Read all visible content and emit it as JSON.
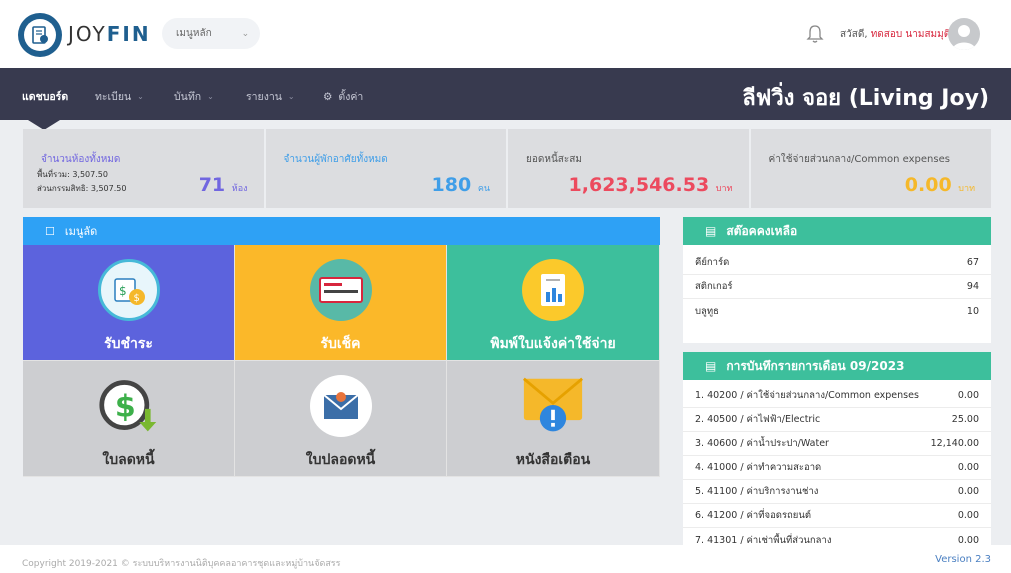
{
  "header": {
    "brand_prefix": "JOY",
    "brand_suffix": "FIN",
    "menu_select": "เมนูหลัก",
    "greeting_prefix": "สวัสดี,",
    "user_name": "ทดสอบ นามสมมุติ"
  },
  "nav": {
    "items": [
      {
        "label": "แดชบอร์ด"
      },
      {
        "label": "ทะเบียน"
      },
      {
        "label": "บันทึก"
      },
      {
        "label": "รายงาน"
      },
      {
        "label": "ตั้งค่า"
      }
    ],
    "project_title": "ลีฟวิ่ง จอย (Living Joy)"
  },
  "stats": [
    {
      "label": "จำนวนห้องทั้งหมด",
      "value": "71",
      "unit": "ห้อง",
      "sub1": "พื้นที่รวม: 3,507.50",
      "sub2": "ส่วนกรรมสิทธิ: 3,507.50",
      "color": "#7166e0"
    },
    {
      "label": "จำนวนผู้พักอาศัยทั้งหมด",
      "value": "180",
      "unit": "คน",
      "color": "#3f9ee8"
    },
    {
      "label": "ยอดหนี้สะสม",
      "value": "1,623,546.53",
      "unit": "บาท",
      "color": "#ec4a5e"
    },
    {
      "label": "ค่าใช้จ่ายส่วนกลาง/Common expenses",
      "value": "0.00",
      "unit": "บาท",
      "color": "#f5b82a"
    }
  ],
  "quick_menu": {
    "title": "เมนูลัด",
    "tiles": [
      {
        "label": "รับชำระ",
        "bg": "#5c63dd"
      },
      {
        "label": "รับเช็ค",
        "bg": "#fbb829"
      },
      {
        "label": "พิมพ์ใบแจ้งค่าใช้จ่าย",
        "bg": "#3dbf9c"
      },
      {
        "label": "ใบลดหนี้"
      },
      {
        "label": "ใบปลอดหนี้"
      },
      {
        "label": "หนังสือเตือน"
      }
    ]
  },
  "stock_panel": {
    "title": "สต๊อคคงเหลือ",
    "rows": [
      {
        "name": "คีย์การ์ด",
        "qty": "67"
      },
      {
        "name": "สติกเกอร์",
        "qty": "94"
      },
      {
        "name": "บลูทูธ",
        "qty": "10"
      }
    ]
  },
  "records_panel": {
    "title": "การบันทึกรายการเดือน 09/2023",
    "rows": [
      {
        "name": "1. 40200 / ค่าใช้จ่ายส่วนกลาง/Common expenses",
        "amount": "0.00"
      },
      {
        "name": "2. 40500 / ค่าไฟฟ้า/Electric",
        "amount": "25.00"
      },
      {
        "name": "3. 40600 / ค่าน้ำประปา/Water",
        "amount": "12,140.00"
      },
      {
        "name": "4. 41000 / ค่าทำความสะอาด",
        "amount": "0.00"
      },
      {
        "name": "5. 41100 / ค่าบริการงานช่าง",
        "amount": "0.00"
      },
      {
        "name": "6. 41200 / ค่าที่จอดรถยนต์",
        "amount": "0.00"
      },
      {
        "name": "7. 41301 / ค่าเช่าพื้นที่ส่วนกลาง",
        "amount": "0.00"
      }
    ]
  },
  "footer": {
    "copyright": "Copyright 2019-2021 © ระบบบริหารงานนิติบุคคลอาคารชุดและหมู่บ้านจัดสรร",
    "version": "Version 2.3"
  },
  "colors": {
    "nav": "#383a4f",
    "accent_blue": "#2ea1f5",
    "accent_green": "#3dbf9c"
  }
}
